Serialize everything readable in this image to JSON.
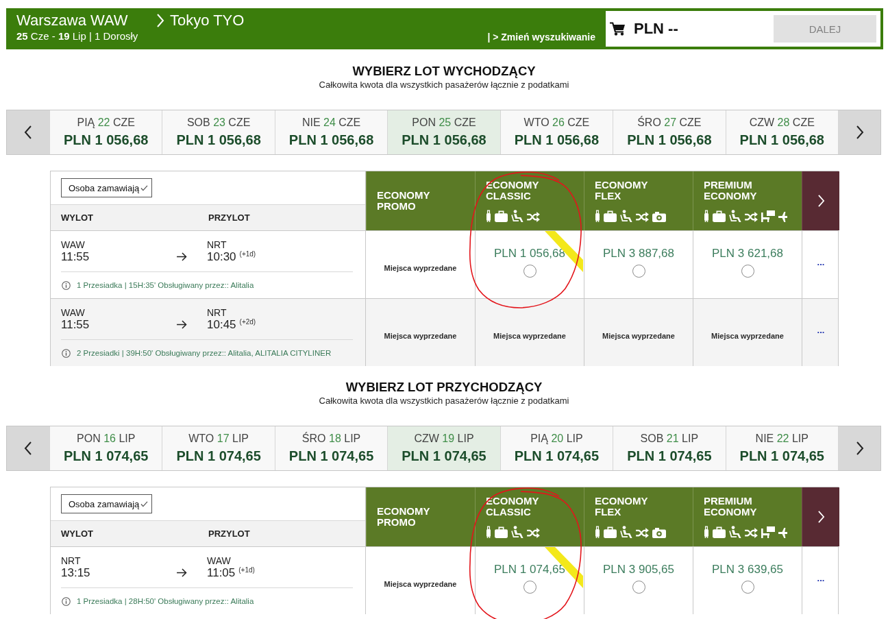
{
  "header": {
    "origin": "Warszawa WAW",
    "destination": "Tokyo TYO",
    "trip_summary": "**25** Cze - **19** Lip | 1 Dorosły",
    "change_search_link": "| > Zmień wyszukiwanie",
    "cart_total": "PLN --",
    "next_button": {
      "label": "DALEJ",
      "disabled": true
    }
  },
  "sections": [
    {
      "title": "WYBIERZ LOT WYCHODZĄCY",
      "subtitle": "Całkowita kwota dla wszystkich pasażerów łącznie z podatkami",
      "dates": [
        {
          "day": "PIĄ",
          "date": "22",
          "month": "CZE",
          "price": "PLN 1 056,68",
          "selected": false
        },
        {
          "day": "SOB",
          "date": "23",
          "month": "CZE",
          "price": "PLN 1 056,68",
          "selected": false
        },
        {
          "day": "NIE",
          "date": "24",
          "month": "CZE",
          "price": "PLN 1 056,68",
          "selected": false
        },
        {
          "day": "PON",
          "date": "25",
          "month": "CZE",
          "price": "PLN 1 056,68",
          "selected": true
        },
        {
          "day": "WTO",
          "date": "26",
          "month": "CZE",
          "price": "PLN 1 056,68",
          "selected": false
        },
        {
          "day": "ŚRO",
          "date": "27",
          "month": "CZE",
          "price": "PLN 1 056,68",
          "selected": false
        },
        {
          "day": "CZW",
          "date": "28",
          "month": "CZE",
          "price": "PLN 1 056,68",
          "selected": false
        }
      ],
      "table": {
        "booker_select": "Osoba zamawiają",
        "departure_heading": "WYLOT",
        "arrival_heading": "PRZYLOT",
        "fares": [
          {
            "name": "ECONOMY PROMO",
            "circled": false
          },
          {
            "name": "ECONOMY CLASSIC",
            "circled": true,
            "amenities": [
              {
                "kind": "cabin-bag"
              },
              {
                "kind": "suitcase"
              },
              {
                "kind": "seat"
              },
              {
                "kind": "shuffle"
              }
            ]
          },
          {
            "name": "ECONOMY FLEX",
            "circled": false,
            "amenities": [
              {
                "kind": "cabin-bag"
              },
              {
                "kind": "suitcase"
              },
              {
                "kind": "seat"
              },
              {
                "kind": "shuffle"
              },
              {
                "kind": "camera"
              }
            ]
          },
          {
            "name": "PREMIUM ECONOMY",
            "circled": false,
            "amenities": [
              {
                "kind": "cabin-bag"
              },
              {
                "kind": "suitcase"
              },
              {
                "kind": "seat"
              },
              {
                "kind": "shuffle"
              },
              {
                "kind": "chair-desk"
              },
              {
                "kind": "plane"
              }
            ]
          }
        ],
        "rows": [
          {
            "origin": "WAW",
            "departure_time": "11:55",
            "destination": "NRT",
            "arrival_time": "10:30",
            "day_offset": "(+1d)",
            "details": "1 Przesiadka | 15H:35' Obsługiwany przez:: Alitalia",
            "fares": [
              {
                "kind": "sold_out",
                "text": "Miejsca wyprzedane"
              },
              {
                "kind": "price",
                "price": "PLN 1 056,68",
                "selected": false
              },
              {
                "kind": "price",
                "price": "PLN 3 887,68",
                "selected": false
              },
              {
                "kind": "price",
                "price": "PLN 3 621,68",
                "selected": false
              }
            ],
            "more": "..."
          },
          {
            "origin": "WAW",
            "departure_time": "11:55",
            "destination": "NRT",
            "arrival_time": "10:45",
            "day_offset": "(+2d)",
            "details": "2 Przesiadki | 39H:50' Obsługiwany przez:: Alitalia, ALITALIA CITYLINER",
            "fares": [
              {
                "kind": "sold_out",
                "text": "Miejsca wyprzedane"
              },
              {
                "kind": "sold_out",
                "text": "Miejsca wyprzedane"
              },
              {
                "kind": "sold_out",
                "text": "Miejsca wyprzedane"
              },
              {
                "kind": "sold_out",
                "text": "Miejsca wyprzedane"
              }
            ],
            "more": "..."
          }
        ]
      }
    },
    {
      "title": "WYBIERZ LOT PRZYCHODZĄCY",
      "subtitle": "Całkowita kwota dla wszystkich pasażerów łącznie z podatkami",
      "dates": [
        {
          "day": "PON",
          "date": "16",
          "month": "LIP",
          "price": "PLN 1 074,65",
          "selected": false
        },
        {
          "day": "WTO",
          "date": "17",
          "month": "LIP",
          "price": "PLN 1 074,65",
          "selected": false
        },
        {
          "day": "ŚRO",
          "date": "18",
          "month": "LIP",
          "price": "PLN 1 074,65",
          "selected": false
        },
        {
          "day": "CZW",
          "date": "19",
          "month": "LIP",
          "price": "PLN 1 074,65",
          "selected": true
        },
        {
          "day": "PIĄ",
          "date": "20",
          "month": "LIP",
          "price": "PLN 1 074,65",
          "selected": false
        },
        {
          "day": "SOB",
          "date": "21",
          "month": "LIP",
          "price": "PLN 1 074,65",
          "selected": false
        },
        {
          "day": "NIE",
          "date": "22",
          "month": "LIP",
          "price": "PLN 1 074,65",
          "selected": false
        }
      ],
      "table": {
        "booker_select": "Osoba zamawiają",
        "departure_heading": "WYLOT",
        "arrival_heading": "PRZYLOT",
        "fares": [
          {
            "name": "ECONOMY PROMO",
            "circled": false
          },
          {
            "name": "ECONOMY CLASSIC",
            "circled": true,
            "amenities": [
              {
                "kind": "cabin-bag"
              },
              {
                "kind": "suitcase"
              },
              {
                "kind": "seat"
              },
              {
                "kind": "shuffle"
              }
            ]
          },
          {
            "name": "ECONOMY FLEX",
            "circled": false,
            "amenities": [
              {
                "kind": "cabin-bag"
              },
              {
                "kind": "suitcase"
              },
              {
                "kind": "seat"
              },
              {
                "kind": "shuffle"
              },
              {
                "kind": "camera"
              }
            ]
          },
          {
            "name": "PREMIUM ECONOMY",
            "circled": false,
            "amenities": [
              {
                "kind": "cabin-bag"
              },
              {
                "kind": "suitcase"
              },
              {
                "kind": "seat"
              },
              {
                "kind": "shuffle"
              },
              {
                "kind": "chair-desk"
              },
              {
                "kind": "plane"
              }
            ]
          }
        ],
        "rows": [
          {
            "origin": "NRT",
            "departure_time": "13:15",
            "destination": "WAW",
            "arrival_time": "11:05",
            "day_offset": "(+1d)",
            "details": "1 Przesiadka | 28H:50' Obsługiwany przez:: Alitalia",
            "fares": [
              {
                "kind": "sold_out",
                "text": "Miejsca wyprzedane"
              },
              {
                "kind": "price",
                "price": "PLN 1 074,65",
                "selected": false
              },
              {
                "kind": "price",
                "price": "PLN 3 905,65",
                "selected": false
              },
              {
                "kind": "price",
                "price": "PLN 3 639,65",
                "selected": false
              }
            ],
            "more": "..."
          }
        ]
      }
    }
  ]
}
